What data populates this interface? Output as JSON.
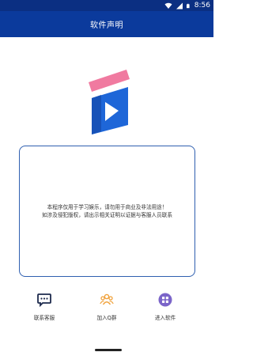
{
  "status_bar": {
    "time": "8:56",
    "icons": [
      "wifi-icon",
      "signal-icon",
      "battery-icon"
    ]
  },
  "app_bar": {
    "title": "软件声明"
  },
  "logo": {
    "icon": "video-play-logo-icon",
    "colors": {
      "clapper_top": "#f07aa0",
      "body": "#1e66d8",
      "play": "#ffffff"
    }
  },
  "notice": {
    "lines": [
      "本程序仅用于学习娱乐，请勿用于商业及非法用途！",
      "如涉及侵犯版权，请出示相关证明以证据与客服人员联系"
    ]
  },
  "actions": [
    {
      "label": "联系客服",
      "icon": "chat-bubble-icon",
      "color": "#1d2a4d"
    },
    {
      "label": "加入Q群",
      "icon": "group-people-icon",
      "color": "#f0a13a"
    },
    {
      "label": "进入软件",
      "icon": "apps-grid-icon",
      "color": "#7b65c9"
    }
  ],
  "theme": {
    "primary": "#0b3a9c",
    "status_bar": "#0b2f82",
    "border": "#2f5fb0"
  }
}
